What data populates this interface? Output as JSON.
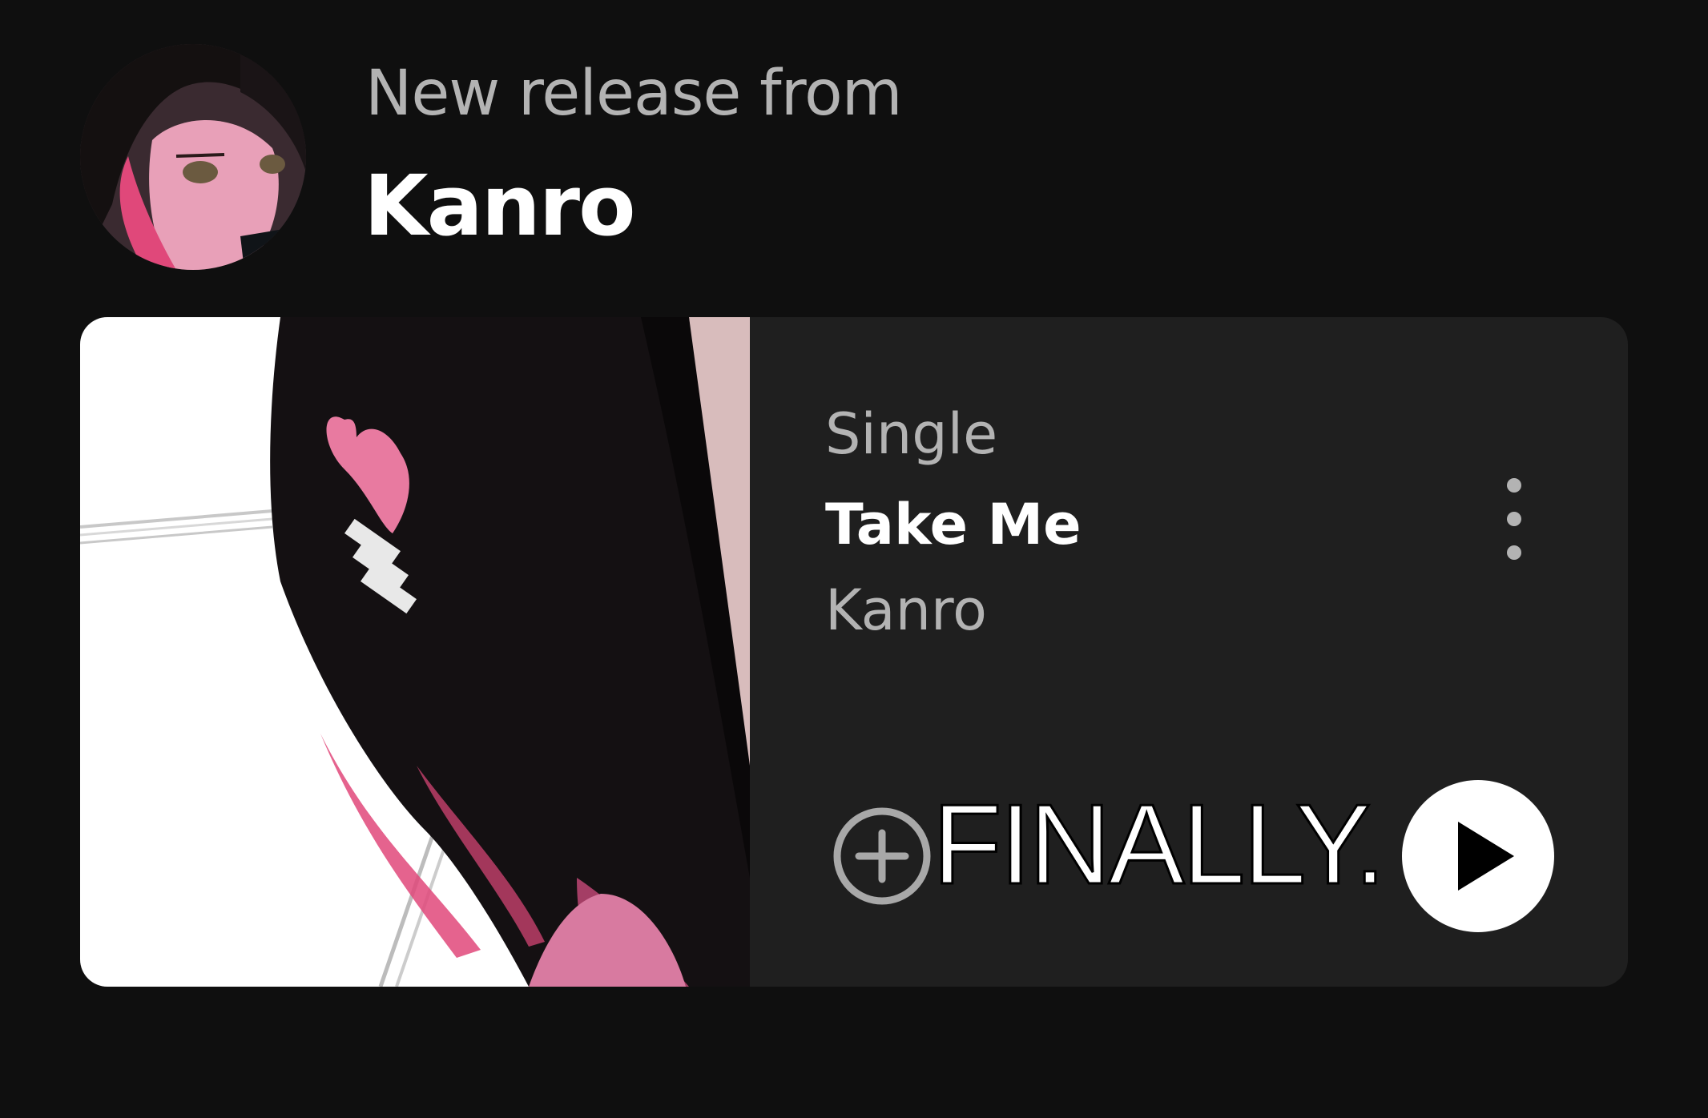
{
  "header": {
    "subtitle": "New release from",
    "artist_name": "Kanro",
    "avatar_icon": "artist-avatar"
  },
  "release": {
    "type": "Single",
    "title": "Take Me",
    "artist": "Kanro",
    "cover_icon": "album-cover-art",
    "more_icon": "more-vertical-icon",
    "add_icon": "add-circle-icon",
    "play_icon": "play-icon"
  },
  "overlay": {
    "caption": "FINALLY."
  },
  "colors": {
    "background": "#0f0f0f",
    "card": "#1f1f1f",
    "primary_text": "#ffffff",
    "secondary_text": "#b3b3b3",
    "accent_pink": "#e87aa0"
  }
}
